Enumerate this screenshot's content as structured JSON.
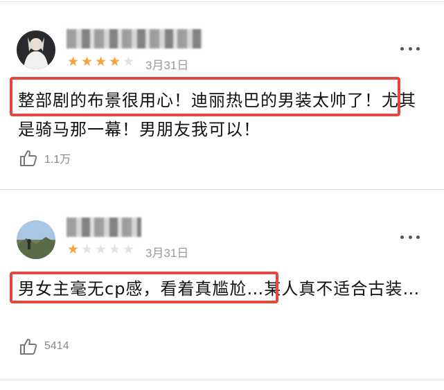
{
  "reviews": [
    {
      "rating": 4,
      "date": "3月31日",
      "text": "整部剧的布景很用心！迪丽热巴的男装太帅了！尤其是骑马那一幕！男朋友我可以！",
      "likes": "1.1万",
      "more_icon": "more-dots-icon",
      "like_icon": "thumbs-up-icon"
    },
    {
      "rating": 1,
      "date": "3月31日",
      "text": "男女主毫无cp感，看着真尴尬…某人真不适合古装…",
      "likes": "5414",
      "more_icon": "more-dots-icon",
      "like_icon": "thumbs-up-icon"
    }
  ],
  "colors": {
    "star_active": "#f2a33a",
    "star_inactive": "#e2e2e2",
    "highlight_border": "#e3483f",
    "muted_text": "#888888"
  }
}
